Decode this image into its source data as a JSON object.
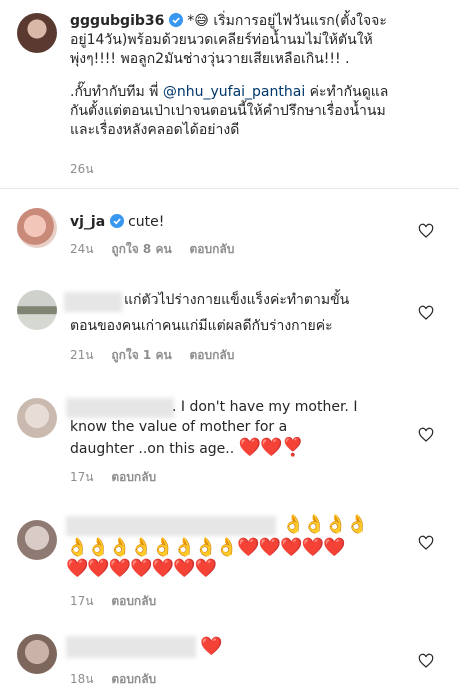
{
  "caption": {
    "username": "gggubgib36",
    "line1": " *😅 เริ่มการอยู่ไฟวันแรก(ตั้งใจจะ",
    "line2": "อยู่14วัน)พร้อมด้วยนวดเคลียร์ท่อน้ำนมไม่ให้ตันให้",
    "line3": "พุ่งๆ!!!! พอลูก2มันช่างวุ่นวายเสียเหลือเกิน!!! .",
    "line4_pre": ".กั๊บทำกับทีม พี่ ",
    "mention": "@nhu_yufai_panthai",
    "line4_post": " ค่ะทำกันดูแล",
    "line5": "กันตั้งแต่ตอนเป่าเปาจนตอนนี้ให้คำปรึกษาเรื่องน้ำนม",
    "line6": "และเรื่องหลังคลอดได้อย่างดี",
    "time": "26น"
  },
  "comments": [
    {
      "username": "vj_ja",
      "text": "cute!",
      "time": "24น",
      "likes": "ถูกใจ 8 คน",
      "reply": "ตอบกลับ"
    },
    {
      "text_line1": "แก่ตัวไปร่างกายแข็งแร็งค่ะทำตามขั้น",
      "text_line2": "ตอนของคนเก่าคนแก่มีแต่ผลดีกับร่างกายค่ะ",
      "time": "21น",
      "likes": "ถูกใจ 1 คน",
      "reply": "ตอบกลับ"
    },
    {
      "text_line1": ". I don't have  my mother. I",
      "text_line2": "know the value of mother for a",
      "text_line3": "daughter ..on this age..",
      "emoji": "❤️❤️❣️",
      "time": "17น",
      "reply": "ตอบกลับ"
    },
    {
      "emoji_line1": "👌👌👌👌",
      "emoji_line2": "👌👌👌👌👌👌👌👌❤️❤️❤️❤️❤️",
      "emoji_line3": "❤️❤️❤️❤️❤️❤️❤️",
      "time": "17น",
      "reply": "ตอบกลับ"
    },
    {
      "emoji": "❤️",
      "time": "18น",
      "reply": "ตอบกลับ"
    }
  ]
}
